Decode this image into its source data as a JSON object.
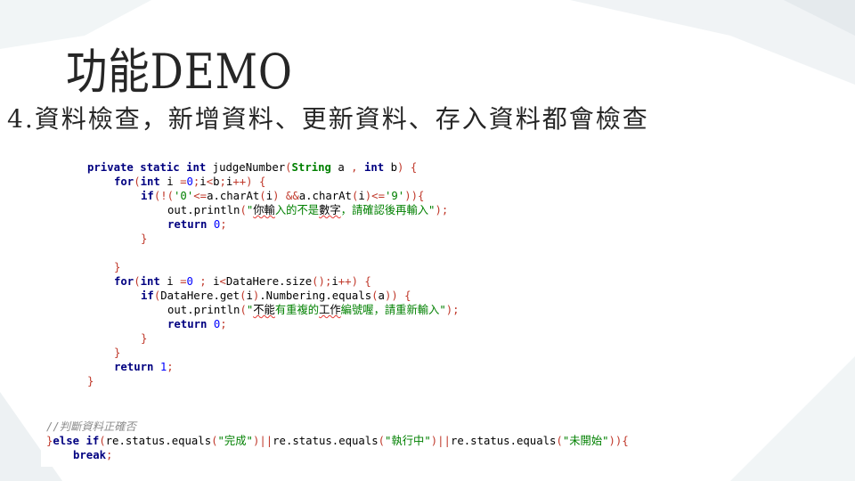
{
  "slide": {
    "title": "功能DEMO",
    "subtitle": "4.資料檢查，新增資料、更新資料、存入資料都會檢查"
  },
  "colors": {
    "keyword": "#000080",
    "type": "#008000",
    "number": "#0000ff",
    "string": "#008000",
    "punctuation": "#c0392b",
    "comment": "#8c8c8c",
    "title_text": "#262626"
  },
  "code_main": {
    "lines": [
      {
        "indent": 0,
        "tokens": [
          [
            "kw",
            "private"
          ],
          [
            "tc",
            " "
          ],
          [
            "kw",
            "static"
          ],
          [
            "tc",
            " "
          ],
          [
            "kw",
            "int"
          ],
          [
            "tc",
            " judgeNumber"
          ],
          [
            "pn",
            "("
          ],
          [
            "ty",
            "String"
          ],
          [
            "tc",
            " a "
          ],
          [
            "pn",
            ","
          ],
          [
            "tc",
            " "
          ],
          [
            "kw",
            "int"
          ],
          [
            "tc",
            " b"
          ],
          [
            "pn",
            ")"
          ],
          [
            "tc",
            " "
          ],
          [
            "pn",
            "{"
          ]
        ]
      },
      {
        "indent": 1,
        "tokens": [
          [
            "kw",
            "for"
          ],
          [
            "pn",
            "("
          ],
          [
            "kw",
            "int"
          ],
          [
            "tc",
            " i "
          ],
          [
            "pn",
            "="
          ],
          [
            "nm",
            "0"
          ],
          [
            "pn",
            ";"
          ],
          [
            "tc",
            "i"
          ],
          [
            "pn",
            "<"
          ],
          [
            "tc",
            "b"
          ],
          [
            "pn",
            ";"
          ],
          [
            "tc",
            "i"
          ],
          [
            "pn",
            "++)"
          ],
          [
            "tc",
            " "
          ],
          [
            "pn",
            "{"
          ]
        ]
      },
      {
        "indent": 2,
        "tokens": [
          [
            "kw",
            "if"
          ],
          [
            "pn",
            "(!("
          ],
          [
            "st",
            "'0'"
          ],
          [
            "pn",
            "<="
          ],
          [
            "tc",
            "a.charAt"
          ],
          [
            "pn",
            "("
          ],
          [
            "tc",
            "i"
          ],
          [
            "pn",
            ")"
          ],
          [
            "tc",
            " "
          ],
          [
            "pn",
            "&&"
          ],
          [
            "tc",
            "a.charAt"
          ],
          [
            "pn",
            "("
          ],
          [
            "tc",
            "i"
          ],
          [
            "pn",
            ")<="
          ],
          [
            "st",
            "'9'"
          ],
          [
            "pn",
            "))"
          ],
          [
            "pn",
            "{"
          ]
        ]
      },
      {
        "indent": 3,
        "tokens": [
          [
            "tc",
            "out.println"
          ],
          [
            "pn",
            "("
          ],
          [
            "st",
            "\""
          ],
          [
            "err",
            "你輸"
          ],
          [
            "st",
            "入的不是"
          ],
          [
            "err",
            "數字"
          ],
          [
            "st",
            "，請確認後再輸入\""
          ],
          [
            "pn",
            ");"
          ]
        ]
      },
      {
        "indent": 3,
        "tokens": [
          [
            "kw",
            "return"
          ],
          [
            "tc",
            " "
          ],
          [
            "nm",
            "0"
          ],
          [
            "pn",
            ";"
          ]
        ]
      },
      {
        "indent": 2,
        "tokens": [
          [
            "pn",
            "}"
          ]
        ]
      },
      {
        "indent": 0,
        "tokens": [
          [
            "tc",
            " "
          ]
        ]
      },
      {
        "indent": 1,
        "tokens": [
          [
            "pn",
            "}"
          ]
        ]
      },
      {
        "indent": 1,
        "tokens": [
          [
            "kw",
            "for"
          ],
          [
            "pn",
            "("
          ],
          [
            "kw",
            "int"
          ],
          [
            "tc",
            " i "
          ],
          [
            "pn",
            "="
          ],
          [
            "nm",
            "0"
          ],
          [
            "tc",
            " "
          ],
          [
            "pn",
            ";"
          ],
          [
            "tc",
            " i"
          ],
          [
            "pn",
            "<"
          ],
          [
            "tc",
            "DataHere.size"
          ],
          [
            "pn",
            "();"
          ],
          [
            "tc",
            "i"
          ],
          [
            "pn",
            "++)"
          ],
          [
            "tc",
            " "
          ],
          [
            "pn",
            "{"
          ]
        ]
      },
      {
        "indent": 2,
        "tokens": [
          [
            "kw",
            "if"
          ],
          [
            "pn",
            "("
          ],
          [
            "tc",
            "DataHere.get"
          ],
          [
            "pn",
            "("
          ],
          [
            "tc",
            "i"
          ],
          [
            "pn",
            ")"
          ],
          [
            "tc",
            ".Numbering.equals"
          ],
          [
            "pn",
            "("
          ],
          [
            "tc",
            "a"
          ],
          [
            "pn",
            "))"
          ],
          [
            "tc",
            " "
          ],
          [
            "pn",
            "{"
          ]
        ]
      },
      {
        "indent": 3,
        "tokens": [
          [
            "tc",
            "out.println"
          ],
          [
            "pn",
            "("
          ],
          [
            "st",
            "\""
          ],
          [
            "err",
            "不能"
          ],
          [
            "st",
            "有重複的"
          ],
          [
            "err",
            "工作"
          ],
          [
            "st",
            "編號喔，請重新輸入\""
          ],
          [
            "pn",
            ");"
          ]
        ]
      },
      {
        "indent": 3,
        "tokens": [
          [
            "kw",
            "return"
          ],
          [
            "tc",
            " "
          ],
          [
            "nm",
            "0"
          ],
          [
            "pn",
            ";"
          ]
        ]
      },
      {
        "indent": 2,
        "tokens": [
          [
            "pn",
            "}"
          ]
        ]
      },
      {
        "indent": 1,
        "tokens": [
          [
            "pn",
            "}"
          ]
        ]
      },
      {
        "indent": 1,
        "tokens": [
          [
            "kw",
            "return"
          ],
          [
            "tc",
            " "
          ],
          [
            "nm",
            "1"
          ],
          [
            "pn",
            ";"
          ]
        ]
      },
      {
        "indent": 0,
        "tokens": [
          [
            "pn",
            "}"
          ]
        ]
      }
    ]
  },
  "code_secondary": {
    "lines": [
      {
        "indent": 0,
        "tokens": [
          [
            "cm",
            "//判斷資料正確否"
          ]
        ]
      },
      {
        "indent": 0,
        "tokens": [
          [
            "pn",
            "}"
          ],
          [
            "kw",
            "else"
          ],
          [
            "tc",
            " "
          ],
          [
            "kw",
            "if"
          ],
          [
            "pn",
            "("
          ],
          [
            "tc",
            "re.status.equals"
          ],
          [
            "pn",
            "("
          ],
          [
            "st",
            "\"完成\""
          ],
          [
            "pn",
            ")||"
          ],
          [
            "tc",
            "re.status.equals"
          ],
          [
            "pn",
            "("
          ],
          [
            "st",
            "\"執行中\""
          ],
          [
            "pn",
            ")||"
          ],
          [
            "tc",
            "re.status.equals"
          ],
          [
            "pn",
            "("
          ],
          [
            "st",
            "\"未開始\""
          ],
          [
            "pn",
            "))"
          ],
          [
            "pn",
            "{"
          ]
        ]
      },
      {
        "indent": 1,
        "tokens": [
          [
            "kw",
            "break"
          ],
          [
            "pn",
            ";"
          ]
        ]
      }
    ]
  }
}
